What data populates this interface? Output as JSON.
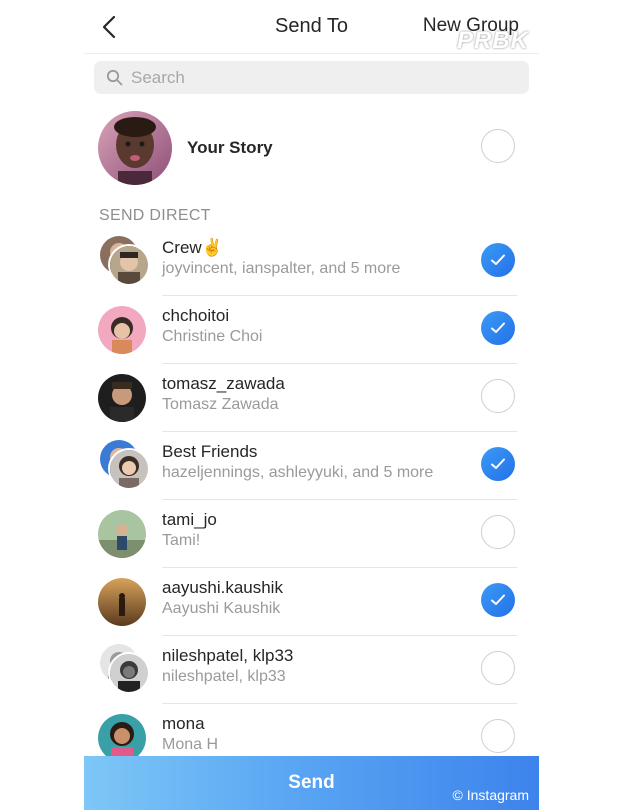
{
  "header": {
    "title": "Send To",
    "new_group": "New Group",
    "watermark": "PRBK"
  },
  "search": {
    "placeholder": "Search",
    "value": ""
  },
  "story": {
    "label": "Your Story",
    "selected": false
  },
  "section_label": "SEND DIRECT",
  "recipients": [
    {
      "name": "Crew✌️",
      "subtitle": "joyvincent, ianspalter, and 5 more",
      "selected": true,
      "group": true
    },
    {
      "name": "chchoitoi",
      "subtitle": "Christine Choi",
      "selected": true,
      "group": false
    },
    {
      "name": "tomasz_zawada",
      "subtitle": "Tomasz Zawada",
      "selected": false,
      "group": false
    },
    {
      "name": "Best Friends",
      "subtitle": "hazeljennings, ashleyyuki, and 5 more",
      "selected": true,
      "group": true
    },
    {
      "name": "tami_jo",
      "subtitle": "Tami!",
      "selected": false,
      "group": false
    },
    {
      "name": "aayushi.kaushik",
      "subtitle": "Aayushi Kaushik",
      "selected": true,
      "group": false
    },
    {
      "name": "nileshpatel, klp33",
      "subtitle": "nileshpatel, klp33",
      "selected": false,
      "group": true
    },
    {
      "name": "mona",
      "subtitle": "Mona H",
      "selected": false,
      "group": false
    }
  ],
  "send": {
    "label": "Send",
    "credit": "© Instagram"
  },
  "colors": {
    "accent": "#3897f0",
    "send_gradient_start": "#7ec7f7",
    "send_gradient_end": "#3d83ec"
  },
  "icons": {
    "back": "chevron-left-icon",
    "search": "search-icon",
    "check": "check-icon"
  }
}
